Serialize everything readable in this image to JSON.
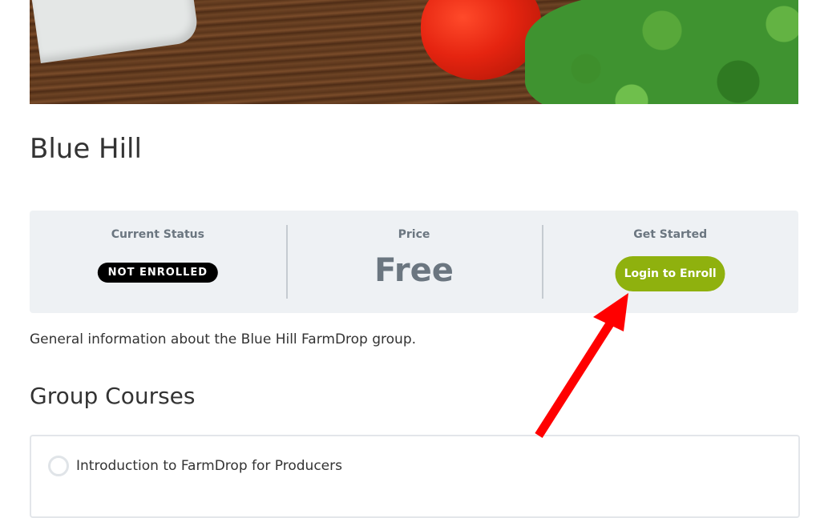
{
  "group": {
    "title": "Blue Hill",
    "description": "General information about the Blue Hill FarmDrop group."
  },
  "status_box": {
    "status_heading": "Current Status",
    "status_badge": "NOT ENROLLED",
    "price_heading": "Price",
    "price_value": "Free",
    "start_heading": "Get Started",
    "enroll_button": "Login to Enroll"
  },
  "courses": {
    "heading": "Group Courses",
    "items": [
      {
        "title": "Introduction to FarmDrop for Producers"
      }
    ]
  },
  "colors": {
    "accent_button": "#8fb10e",
    "badge_bg": "#000000",
    "annotation_arrow": "#ff0000"
  }
}
